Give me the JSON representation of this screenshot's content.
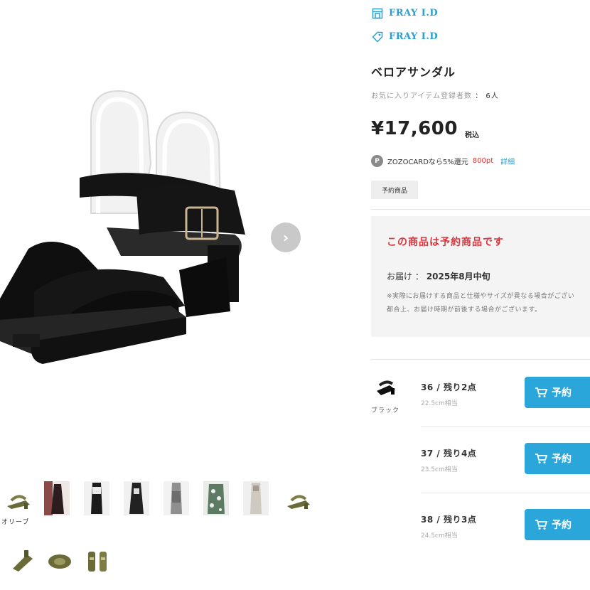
{
  "gallery": {
    "next_icon": "›",
    "thumb_caption": "オリーブ",
    "thumbs": [
      {
        "name": "olive-sandal"
      },
      {
        "name": "model-red-dress"
      },
      {
        "name": "model-black-outfit"
      },
      {
        "name": "model-black-pants"
      },
      {
        "name": "model-grey-outfit"
      },
      {
        "name": "model-floral"
      },
      {
        "name": "model-white"
      },
      {
        "name": "olive-sandal-2"
      },
      {
        "name": "olive-sandal-side"
      },
      {
        "name": "olive-sandal-top"
      },
      {
        "name": "olive-sandal-pair"
      }
    ]
  },
  "brand": {
    "shop_name": "FRAY I.D",
    "brand_name": "FRAY I.D"
  },
  "product": {
    "name": "ベロアサンダル",
    "favorite_label": "お気に入りアイテム登録者数",
    "favorite_sep": "：",
    "favorite_count": "6人",
    "price": "¥17,600",
    "tax_label": "税込",
    "zozo_badge": "P",
    "zozo_text": "ZOZOCARDなら5%還元",
    "zozo_points": "800pt",
    "zozo_detail": "詳細",
    "tag": "予約商品"
  },
  "reservation": {
    "title": "この商品は予約商品です",
    "delivery_label": "お届け ：",
    "delivery_value": "2025年8月中旬",
    "note": "※実際にお届けする商品と仕様やサイズが異なる場合がござい\n都合上、お届け時期が前後する場合がございます。"
  },
  "skus": {
    "color_label": "ブラック",
    "items": [
      {
        "size": "36 / 残り2点",
        "cm": "22.5cm相当",
        "button": "予約"
      },
      {
        "size": "37 / 残り4点",
        "cm": "23.5cm相当",
        "button": "予約"
      },
      {
        "size": "38 / 残り3点",
        "cm": "24.5cm相当",
        "button": "予約"
      }
    ]
  },
  "colors": {
    "accent": "#2ba6db",
    "brand_text": "#2a9fd0",
    "reserve_red": "#d9363e",
    "points_red": "#dd3333"
  }
}
